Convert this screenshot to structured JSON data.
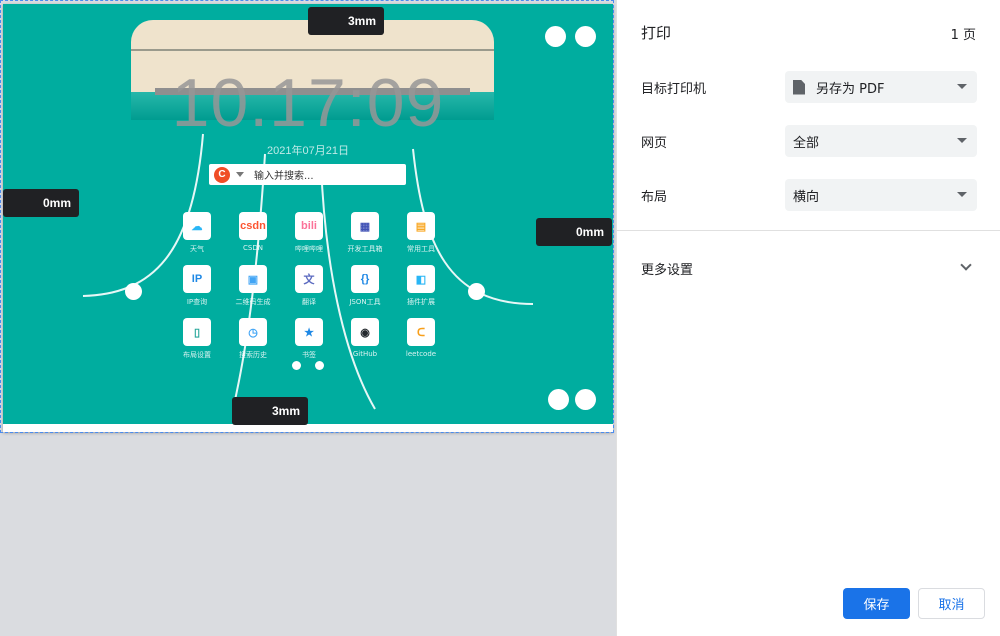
{
  "preview": {
    "margins": {
      "top": "3mm",
      "left": "0mm",
      "right": "0mm",
      "bottom": "3mm"
    },
    "page": {
      "clock": "10.17:09",
      "date": "2021年07月21日",
      "search_placeholder": "输入并搜索...",
      "search_logo": "C",
      "apps": [
        {
          "label": "天气",
          "icon": "weather-icon",
          "glyph": "☁",
          "color": "#29b6f6"
        },
        {
          "label": "CSDN",
          "icon": "csdn-icon",
          "glyph": "csdn",
          "color": "#fc5531"
        },
        {
          "label": "哔哩哔哩",
          "icon": "bilibili-icon",
          "glyph": "bili",
          "color": "#fb7299"
        },
        {
          "label": "开发工具箱",
          "icon": "devtools-icon",
          "glyph": "▦",
          "color": "#3f51b5"
        },
        {
          "label": "常用工具",
          "icon": "tools-icon",
          "glyph": "▤",
          "color": "#f9a825"
        },
        {
          "label": "IP查询",
          "icon": "ip-icon",
          "glyph": "IP",
          "color": "#1e88e5"
        },
        {
          "label": "二维码生成",
          "icon": "qrcode-icon",
          "glyph": "▣",
          "color": "#42a5f5"
        },
        {
          "label": "翻译",
          "icon": "translate-icon",
          "glyph": "文",
          "color": "#5c6bc0"
        },
        {
          "label": "JSON工具",
          "icon": "json-icon",
          "glyph": "{}",
          "color": "#1e88e5"
        },
        {
          "label": "插件扩展",
          "icon": "extension-icon",
          "glyph": "◧",
          "color": "#29b6f6"
        },
        {
          "label": "布局设置",
          "icon": "layout-icon",
          "glyph": "▯",
          "color": "#26a69a"
        },
        {
          "label": "搜索历史",
          "icon": "history-icon",
          "glyph": "◷",
          "color": "#42a5f5"
        },
        {
          "label": "书签",
          "icon": "bookmark-star-icon",
          "glyph": "★",
          "color": "#1e88e5"
        },
        {
          "label": "GitHub",
          "icon": "github-icon",
          "glyph": "◉",
          "color": "#24292e"
        },
        {
          "label": "leetcode",
          "icon": "leetcode-icon",
          "glyph": "ᑕ",
          "color": "#f89f1b"
        }
      ]
    }
  },
  "settings": {
    "title": "打印",
    "page_count": "1 页",
    "destination": {
      "label": "目标打印机",
      "value": "另存为 PDF"
    },
    "pages": {
      "label": "网页",
      "value": "全部"
    },
    "layout": {
      "label": "布局",
      "value": "横向"
    },
    "more_settings": "更多设置",
    "save_button": "保存",
    "cancel_button": "取消"
  },
  "colors": {
    "accent": "#1a73e8",
    "page_bg": "#00ad9f"
  }
}
